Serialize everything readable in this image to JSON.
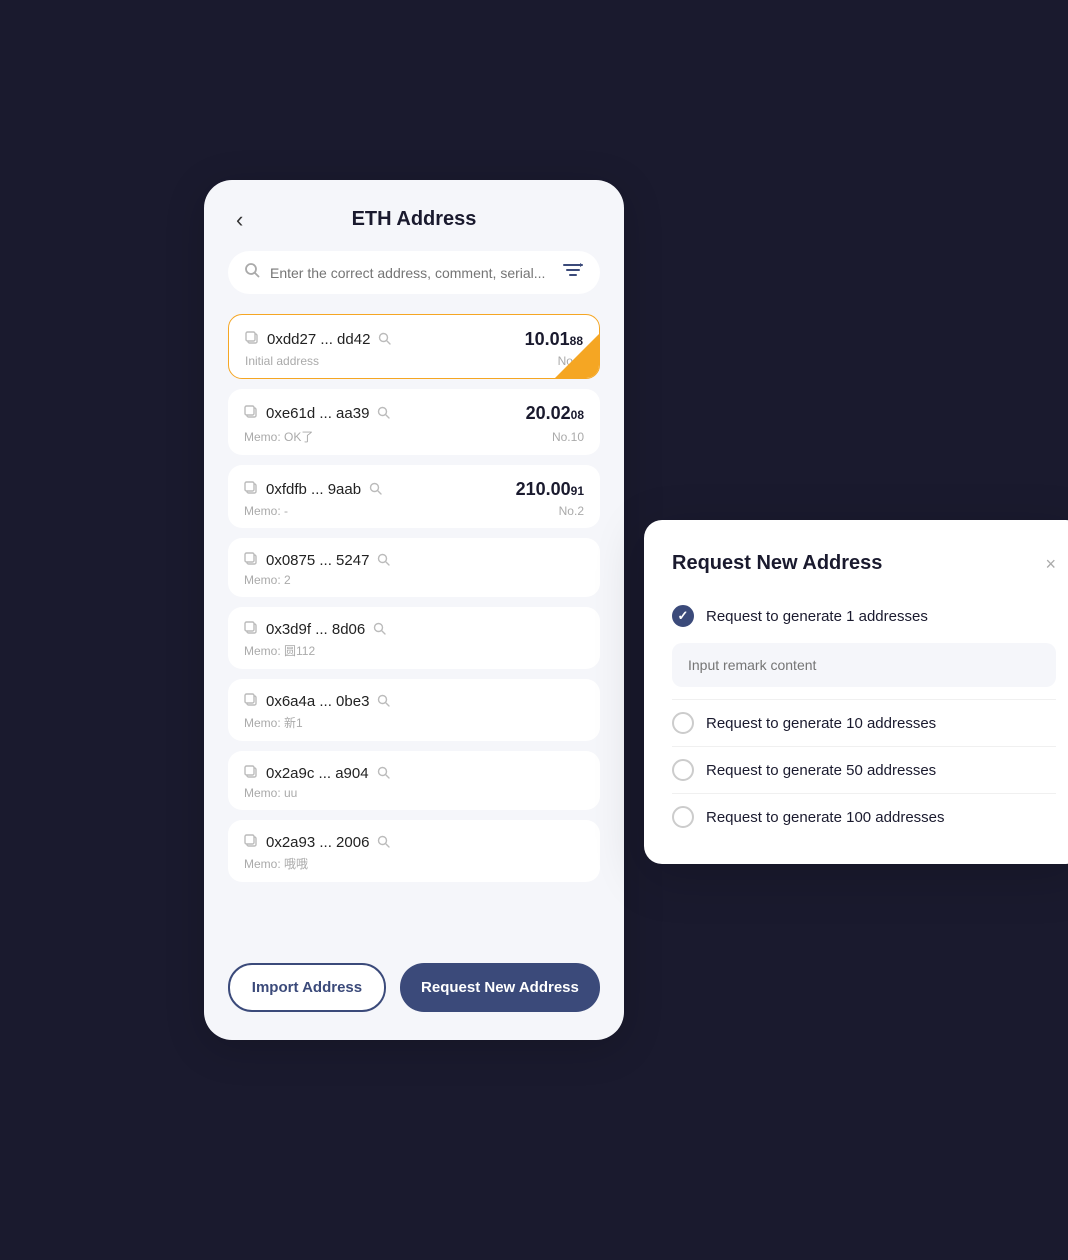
{
  "page": {
    "title": "ETH Address",
    "back_label": "‹"
  },
  "search": {
    "placeholder": "Enter the correct address, comment, serial..."
  },
  "addresses": [
    {
      "id": "addr-1",
      "address": "0xdd27 ... dd42",
      "memo": "Initial address",
      "amount_main": "10.01",
      "amount_small": "88",
      "no": "No.0",
      "active": true
    },
    {
      "id": "addr-2",
      "address": "0xe61d ... aa39",
      "memo": "Memo: OK了",
      "amount_main": "20.02",
      "amount_small": "08",
      "no": "No.10",
      "active": false
    },
    {
      "id": "addr-3",
      "address": "0xfdfb ... 9aab",
      "memo": "Memo: -",
      "amount_main": "210.00",
      "amount_small": "91",
      "no": "No.2",
      "active": false
    },
    {
      "id": "addr-4",
      "address": "0x0875 ... 5247",
      "memo": "Memo: 2",
      "amount_main": "",
      "amount_small": "",
      "no": "",
      "active": false
    },
    {
      "id": "addr-5",
      "address": "0x3d9f ... 8d06",
      "memo": "Memo: 圆112",
      "amount_main": "",
      "amount_small": "",
      "no": "",
      "active": false
    },
    {
      "id": "addr-6",
      "address": "0x6a4a ... 0be3",
      "memo": "Memo: 新1",
      "amount_main": "",
      "amount_small": "",
      "no": "",
      "active": false
    },
    {
      "id": "addr-7",
      "address": "0x2a9c ... a904",
      "memo": "Memo: uu",
      "amount_main": "",
      "amount_small": "",
      "no": "",
      "active": false
    },
    {
      "id": "addr-8",
      "address": "0x2a93 ... 2006",
      "memo": "Memo: 哦哦",
      "amount_main": "",
      "amount_small": "",
      "no": "",
      "active": false
    }
  ],
  "buttons": {
    "import": "Import Address",
    "request": "Request New Address"
  },
  "modal": {
    "title": "Request New Address",
    "close_label": "×",
    "remark_placeholder": "Input remark content",
    "options": [
      {
        "id": "opt-1",
        "label": "Request to generate 1 addresses",
        "checked": true
      },
      {
        "id": "opt-10",
        "label": "Request to generate 10 addresses",
        "checked": false
      },
      {
        "id": "opt-50",
        "label": "Request to generate 50 addresses",
        "checked": false
      },
      {
        "id": "opt-100",
        "label": "Request to generate 100 addresses",
        "checked": false
      }
    ]
  }
}
